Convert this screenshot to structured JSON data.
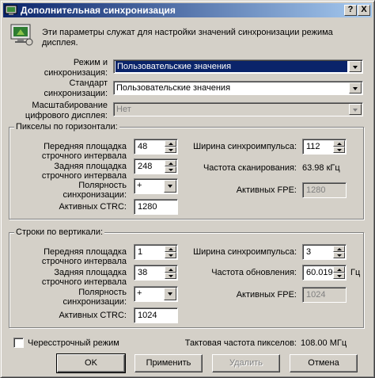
{
  "window": {
    "title": "Дополнительная синхронизация",
    "help_button": "?",
    "close_button": "X"
  },
  "intro": {
    "text_line1": "Эти параметры служат для настройки значений синхронизации режима",
    "text_line2": "дисплея."
  },
  "mode": {
    "label_line1": "Режим и",
    "label_line2": "синхронизация:",
    "value": "Пользовательские значения"
  },
  "standard": {
    "label_line1": "Стандарт",
    "label_line2": "синхронизации:",
    "value": "Пользовательские значения"
  },
  "scaling": {
    "label_line1": "Масштабирование",
    "label_line2": "цифрового дисплея:",
    "value": "Нет"
  },
  "horizontal": {
    "legend": "Пикселы по горизонтали:",
    "front_porch_label1": "Передняя площадка",
    "front_porch_label2": "строчного интервала",
    "front_porch": "48",
    "back_porch_label1": "Задняя площадка",
    "back_porch_label2": "строчного интервала",
    "back_porch": "248",
    "polarity_label1": "Полярность",
    "polarity_label2": "синхронизации:",
    "polarity": "+",
    "active_crtc_label": "Активных CTRC:",
    "active_crtc": "1280",
    "sync_width_label": "Ширина синхроимпульса:",
    "sync_width": "112",
    "scan_rate_label": "Частота сканирования:",
    "scan_rate": "63.98 кГц",
    "active_fpe_label": "Активных FPE:",
    "active_fpe": "1280"
  },
  "vertical": {
    "legend": "Строки по вертикали:",
    "front_porch_label1": "Передняя площадка",
    "front_porch_label2": "строчного интервала",
    "front_porch": "1",
    "back_porch_label1": "Задняя площадка",
    "back_porch_label2": "строчного интервала",
    "back_porch": "38",
    "polarity_label1": "Полярность",
    "polarity_label2": "синхронизации:",
    "polarity": "+",
    "active_crtc_label": "Активных CTRC:",
    "active_crtc": "1024",
    "sync_width_label": "Ширина синхроимпульса:",
    "sync_width": "3",
    "refresh_label": "Частота обновления:",
    "refresh": "60.019",
    "refresh_unit": "Гц",
    "active_fpe_label": "Активных FPE:",
    "active_fpe": "1024"
  },
  "interlaced": {
    "label": "Чересстрочный режим",
    "checked": false
  },
  "pixel_clock": {
    "label": "Тактовая частота пикселов:",
    "value": "108.00 МГц"
  },
  "buttons": {
    "ok": "OK",
    "apply": "Применить",
    "delete": "Удалить",
    "cancel": "Отмена"
  }
}
